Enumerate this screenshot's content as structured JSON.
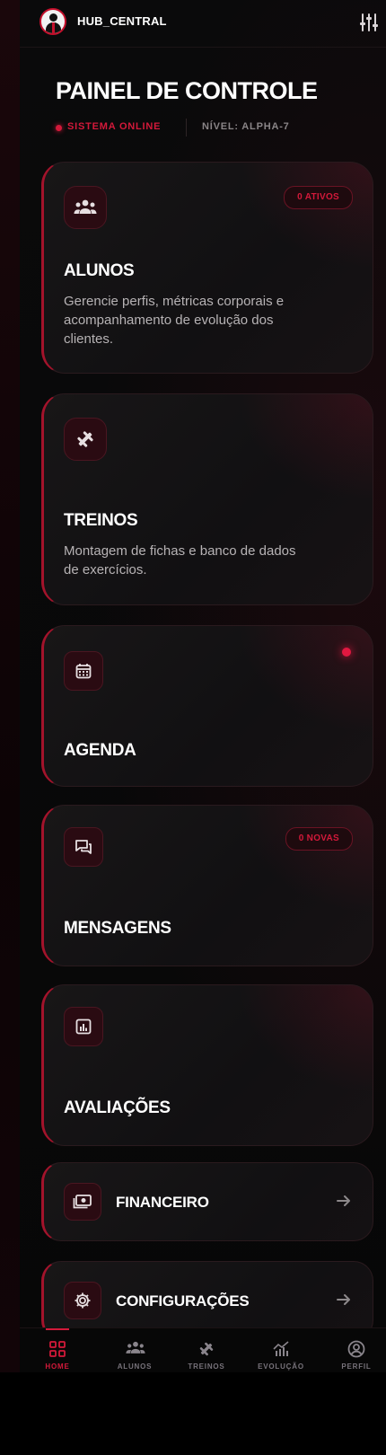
{
  "header": {
    "brand": "HUB_CENTRAL"
  },
  "page": {
    "title": "PAINEL DE CONTROLE",
    "status": "SISTEMA ONLINE",
    "level": "NÍVEL: ALPHA-7"
  },
  "cards": {
    "alunos": {
      "title": "ALUNOS",
      "badge": "0 ATIVOS",
      "description": "Gerencie perfis, métricas corporais e acompanhamento de evolução dos clientes.",
      "icon": "group-icon"
    },
    "treinos": {
      "title": "TREINOS",
      "description": "Montagem de fichas e banco de dados de exercícios.",
      "icon": "dumbbell-icon"
    },
    "agenda": {
      "title": "AGENDA",
      "icon": "calendar-icon"
    },
    "mensagens": {
      "title": "MENSAGENS",
      "badge": "0 NOVAS",
      "icon": "chat-icon"
    },
    "avaliacoes": {
      "title": "AVALIAÇÕES",
      "icon": "analytics-icon"
    }
  },
  "rows": {
    "financeiro": {
      "label": "FINANCEIRO",
      "icon": "money-icon"
    },
    "configuracoes": {
      "label": "CONFIGURAÇÕES",
      "icon": "gear-icon"
    }
  },
  "nav": {
    "home": "HOME",
    "alunos": "ALUNOS",
    "treinos": "TREINOS",
    "evolucao": "EVOLUÇÃO",
    "perfil": "PERFIL",
    "active": "home"
  },
  "colors": {
    "accent": "#d3193a",
    "background": "#070707",
    "card": "#141213"
  }
}
